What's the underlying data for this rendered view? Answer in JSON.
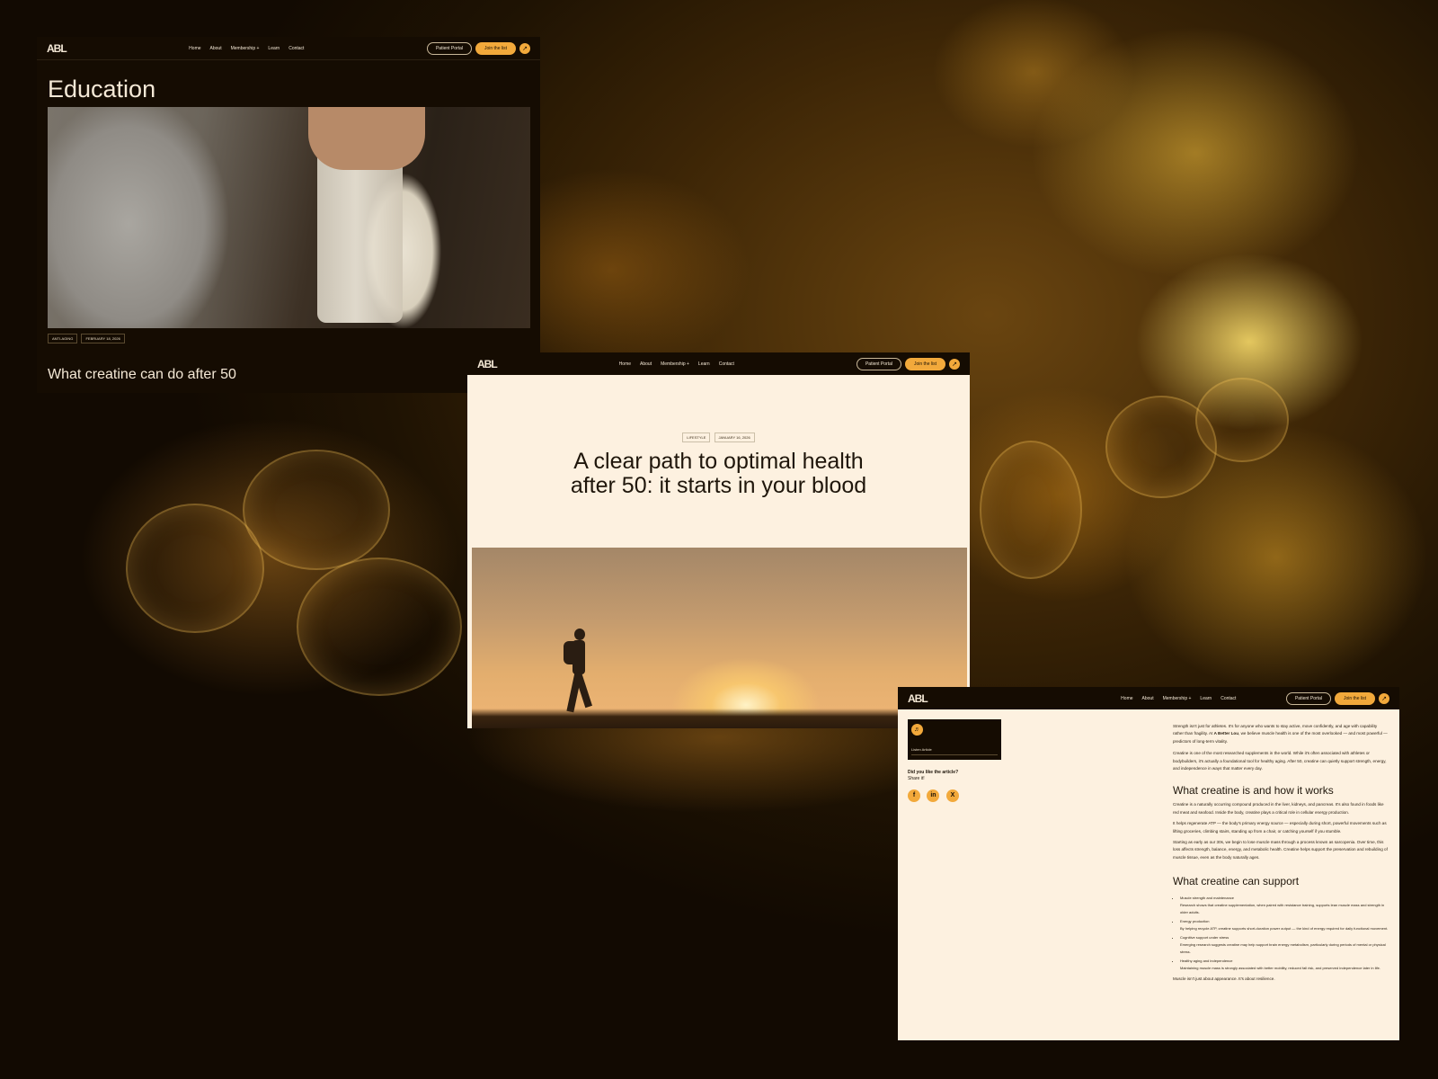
{
  "nav": {
    "logo": "ABL",
    "links": [
      "Home",
      "About",
      "Membership",
      "Learn",
      "Contact"
    ],
    "membership_chevron": "+",
    "patient_portal": "Patient Portal",
    "join": "Join the list",
    "arrow": "↗"
  },
  "shot1": {
    "heading": "Education",
    "tags": [
      "ANTI-AGING",
      "FEBRUARY 18, 2026"
    ],
    "title": "What creatine can do after 50",
    "image_icon": "shaker-bottle-photo"
  },
  "shot2": {
    "tags": [
      "LIFESTYLE",
      "JANUARY 16, 2026"
    ],
    "title_line1": "A clear path to optimal health",
    "title_line2": "after 50: it starts in your blood",
    "image_icon": "hiker-sunset-photo"
  },
  "shot3": {
    "listen_label": "Listen Article",
    "speaker_icon": "speaker-icon",
    "share_q": "Did you like the article?",
    "share_cta": "Share it!",
    "social": [
      "f",
      "in",
      "X"
    ],
    "intro1_a": "Strength isn't just for athletes. It's for anyone who wants to stay active, move confidently, and age with capability rather than fragility. At ",
    "intro1_b": "A Better Lou",
    "intro1_c": ", we believe muscle health is one of the most overlooked — and most powerful — predictors of long-term vitality.",
    "intro2": "Creatine is one of the most researched supplements in the world. While it's often associated with athletes or bodybuilders, it's actually a foundational tool for healthy aging. After 50, creatine can quietly support strength, energy, and independence in ways that matter every day.",
    "h2a": "What creatine is and how it works",
    "p1": "Creatine is a naturally occurring compound produced in the liver, kidneys, and pancreas. It's also found in foods like red meat and seafood. Inside the body, creatine plays a critical role in cellular energy production.",
    "p2": "It helps regenerate ATP — the body's primary energy source — especially during short, powerful movements such as lifting groceries, climbing stairs, standing up from a chair, or catching yourself if you stumble.",
    "p3": "Starting as early as our 30s, we begin to lose muscle mass through a process known as sarcopenia. Over time, this loss affects strength, balance, energy, and metabolic health. Creatine helps support the preservation and rebuilding of muscle tissue, even as the body naturally ages.",
    "h2b": "What creatine can support",
    "list": [
      {
        "t": "Muscle strength and maintenance",
        "d": "Research shows that creatine supplementation, when paired with resistance training, supports lean muscle mass and strength in older adults."
      },
      {
        "t": "Energy production",
        "d": "By helping recycle ATP, creatine supports short-duration power output — the kind of energy required for daily functional movement."
      },
      {
        "t": "Cognitive support under stress",
        "d": "Emerging research suggests creatine may help support brain energy metabolism, particularly during periods of mental or physical stress."
      },
      {
        "t": "Healthy aging and independence",
        "d": "Maintaining muscle mass is strongly associated with better mobility, reduced fall risk, and preserved independence later in life."
      }
    ],
    "closing": "Muscle isn't just about appearance. It's about resilience."
  },
  "colors": {
    "accent": "#f2a93b",
    "dark": "#150c02",
    "cream": "#fdf1e0"
  }
}
